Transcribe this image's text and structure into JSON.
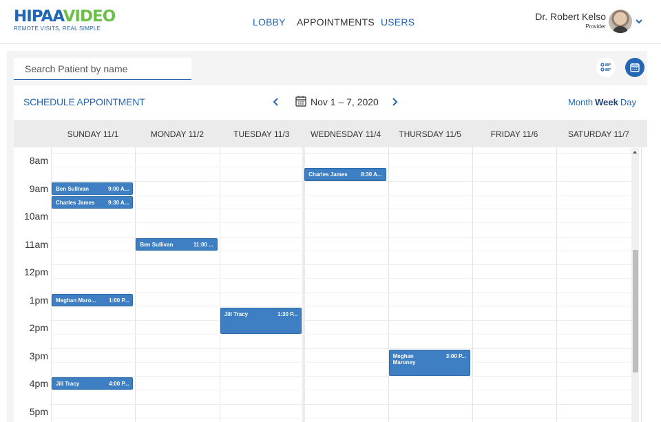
{
  "header": {
    "logo_left": "HIPAA",
    "logo_right": "VIDEO",
    "tagline": "REMOTE VISITS, REAL SIMPLE",
    "nav": {
      "lobby": "LOBBY",
      "appointments": "APPOINTMENTS",
      "users": "USERS"
    },
    "user_name": "Dr. Robert Kelso",
    "user_role": "Provider"
  },
  "toolbar": {
    "search_placeholder": "Search Patient by name"
  },
  "schedule": {
    "title": "SCHEDULE APPOINTMENT",
    "date_range": "Nov 1 – 7, 2020",
    "views": {
      "month": "Month",
      "week": "Week",
      "day": "Day"
    },
    "active_view": "Week"
  },
  "days": [
    "SUNDAY 11/1",
    "MONDAY 11/2",
    "TUESDAY 11/3",
    "WEDNESDAY 11/4",
    "THURSDAY 11/5",
    "FRIDAY 11/6",
    "SATURDAY 11/7"
  ],
  "times": [
    "8am",
    "9am",
    "10am",
    "11am",
    "12pm",
    "1pm",
    "2pm",
    "3pm",
    "4pm",
    "5pm"
  ],
  "events": [
    {
      "name": "Ben Sullivan",
      "time": "9:00 A...",
      "day": 0,
      "start": 9.0,
      "end": 9.5
    },
    {
      "name": "Charles James",
      "time": "9:30 A...",
      "day": 0,
      "start": 9.5,
      "end": 10.0
    },
    {
      "name": "Charles James",
      "time": "8:30 A...",
      "day": 3,
      "start": 8.5,
      "end": 9.0
    },
    {
      "name": "Ben Sullivan",
      "time": "11:00 ...",
      "day": 1,
      "start": 11.0,
      "end": 11.5
    },
    {
      "name": "Meghan Maro...",
      "time": "1:00 P...",
      "day": 0,
      "start": 13.0,
      "end": 13.5
    },
    {
      "name": "Jill Tracy",
      "time": "1:30 P...",
      "day": 2,
      "start": 13.5,
      "end": 14.5
    },
    {
      "name": "Meghan Maroney",
      "time": "3:00 P...",
      "day": 4,
      "start": 15.0,
      "end": 16.0
    },
    {
      "name": "Jill Tracy",
      "time": "4:00 P...",
      "day": 0,
      "start": 16.0,
      "end": 16.5
    }
  ],
  "colors": {
    "brand_blue": "#2266b4",
    "brand_green": "#6cc04a",
    "event": "#3d7fc2"
  }
}
